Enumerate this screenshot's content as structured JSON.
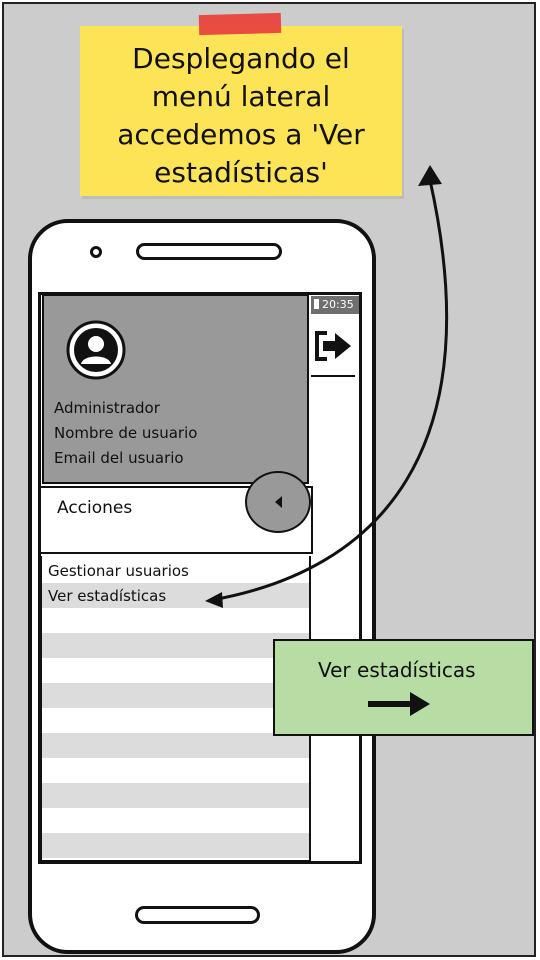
{
  "note": {
    "text": "Desplegando el menú lateral accedemos a 'Ver estadísticas'"
  },
  "status_bar": {
    "time": "20:35"
  },
  "drawer": {
    "user_role": "Administrador",
    "username": "Nombre de usuario",
    "email": "Email del usuario",
    "section_title": "Acciones",
    "items": [
      {
        "label": "Gestionar usuarios"
      },
      {
        "label": "Ver estadísticas"
      }
    ]
  },
  "callout": {
    "text": "Ver estadísticas"
  },
  "icons": {
    "avatar": "user-avatar-icon",
    "logout": "logout-icon",
    "collapse": "chevron-left-icon",
    "callout_arrow": "arrow-right-icon",
    "battery": "battery-icon"
  },
  "colors": {
    "note_yellow": "#fde457",
    "tape_red": "#e8453c",
    "drawer_header_gray": "#999999",
    "callout_green": "#b7dca4",
    "background_gray": "#cccccc"
  }
}
